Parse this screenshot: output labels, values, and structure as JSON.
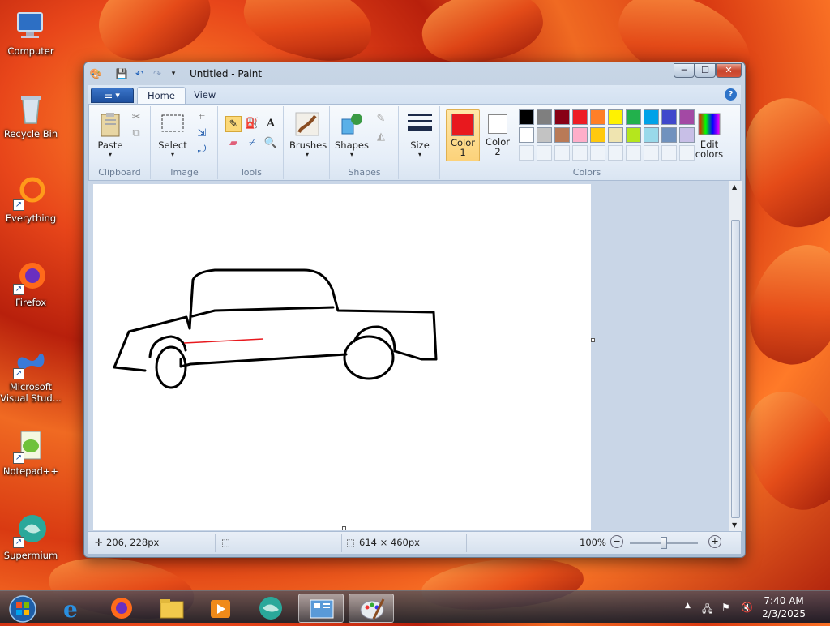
{
  "desktop": {
    "icons": [
      {
        "label": "Computer",
        "icon": "computer-icon"
      },
      {
        "label": "Recycle Bin",
        "icon": "recycle-bin-icon"
      },
      {
        "label": "Everything",
        "icon": "everything-icon"
      },
      {
        "label": "Firefox",
        "icon": "firefox-icon"
      },
      {
        "label": "Microsoft Visual Stud...",
        "icon": "visual-studio-icon"
      },
      {
        "label": "Notepad++",
        "icon": "notepadpp-icon"
      },
      {
        "label": "Supermium",
        "icon": "supermium-icon"
      }
    ]
  },
  "window": {
    "title": "Untitled - Paint",
    "controls": {
      "minimize": "─",
      "maximize": "☐",
      "close": "✕"
    }
  },
  "menu": {
    "file_glyph": "☰ ▾",
    "tabs": [
      "Home",
      "View"
    ],
    "help": "?"
  },
  "ribbon": {
    "groups": {
      "clipboard": {
        "label": "Clipboard",
        "paste": "Paste"
      },
      "image": {
        "label": "Image",
        "select": "Select"
      },
      "tools": {
        "label": "Tools"
      },
      "brushes": {
        "label": "Brushes"
      },
      "shapes": {
        "label": "Shapes",
        "button": "Shapes"
      },
      "size": {
        "label": "Size"
      },
      "colors": {
        "label": "Colors",
        "color1": "Color 1",
        "color2": "Color 2",
        "edit": "Edit colors"
      }
    },
    "color1_value": "#e8191e",
    "color2_value": "#ffffff",
    "palette_row1": [
      "#000000",
      "#7f7f7f",
      "#880015",
      "#ed1c24",
      "#ff7f27",
      "#fff200",
      "#22b14c",
      "#00a2e8",
      "#3f48cc",
      "#a349a4"
    ],
    "palette_row2": [
      "#ffffff",
      "#c3c3c3",
      "#b97a57",
      "#ffaec9",
      "#ffc90e",
      "#efe4b0",
      "#b5e61d",
      "#99d9ea",
      "#7092be",
      "#c8bfe7"
    ]
  },
  "status": {
    "cursor_pos": "206, 228px",
    "canvas_size": "614 × 460px",
    "zoom": "100%"
  },
  "taskbar": {
    "apps": [
      "start-orb-icon",
      "internet-explorer-icon",
      "firefox-icon",
      "file-explorer-icon",
      "media-player-icon",
      "supermium-icon",
      "control-panel-icon",
      "paint-icon"
    ],
    "time": "7:40 AM",
    "date": "2/3/2025"
  }
}
